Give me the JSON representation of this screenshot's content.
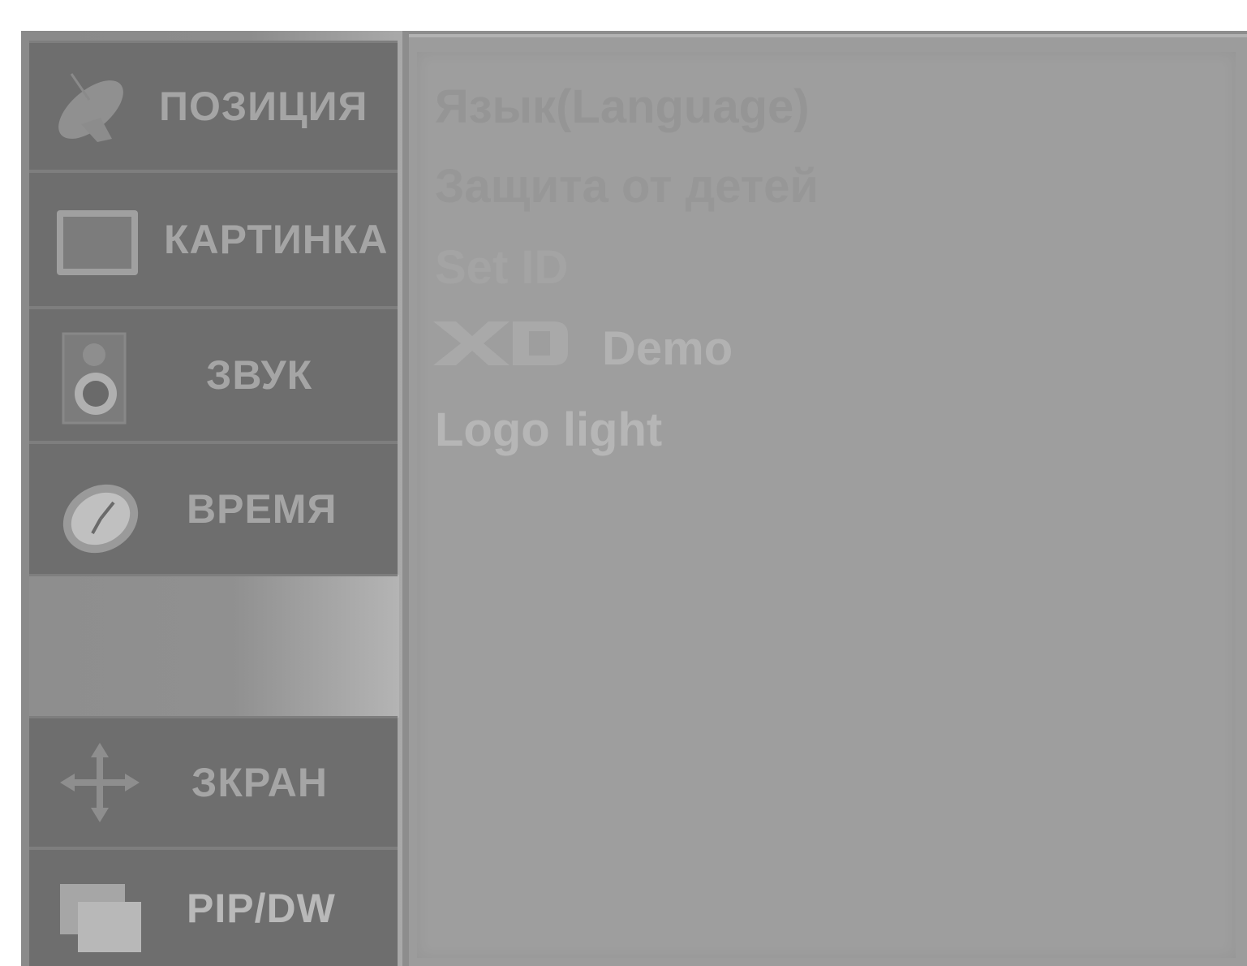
{
  "menu": {
    "items": [
      {
        "label": "ПОЗИЦИЯ",
        "icon": "satellite-dish-icon"
      },
      {
        "label": "КАРТИНКА",
        "icon": "picture-icon"
      },
      {
        "label": "ЗВУК",
        "icon": "speaker-icon"
      },
      {
        "label": "ВРЕМЯ",
        "icon": "clock-icon"
      },
      {
        "label": "ЗКРАН",
        "icon": "move-arrows-icon"
      },
      {
        "label": "PIP/DW",
        "icon": "pip-windows-icon"
      }
    ]
  },
  "submenu": {
    "items": [
      {
        "label": "Язык(Language)"
      },
      {
        "label": "Защита от детей"
      },
      {
        "label": "Set ID"
      },
      {
        "label": "Demo",
        "logo": "XD"
      },
      {
        "label": "Logo light"
      }
    ]
  },
  "colors": {
    "menu_bg": "#6e6e6e",
    "menu_text": "#a5a5a5",
    "content_bg": "#9c9c9c",
    "option_text_dim": "#959595",
    "option_text_bright": "#b4b4b4"
  }
}
